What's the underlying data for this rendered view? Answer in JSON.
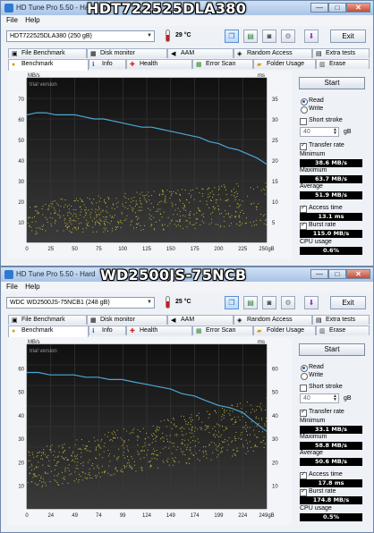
{
  "windows": [
    {
      "title": "HD Tune Pro 5.50 - Hard",
      "overlay_label": "HDT722525DLA380",
      "menu": {
        "file": "File",
        "help": "Help"
      },
      "drive_select": "HDT722525DLA380 (250 gB)",
      "temperature": "29 °C",
      "window_controls": {
        "minimize": "—",
        "maximize": "□",
        "close": "✕"
      },
      "exit_label": "Exit",
      "tabs_row1": [
        "File Benchmark",
        "Disk monitor",
        "AAM",
        "Random Access",
        "Extra tests"
      ],
      "tabs_row2": [
        "Benchmark",
        "Info",
        "Health",
        "Error Scan",
        "Folder Usage",
        "Erase"
      ],
      "side": {
        "start": "Start",
        "read": "Read",
        "write": "Write",
        "short_stroke": "Short stroke",
        "short_stroke_value": "40",
        "unit_gb": "gB",
        "transfer_rate": "Transfer rate",
        "minimum_label": "Minimum",
        "minimum": "38.6 MB/s",
        "maximum_label": "Maximum",
        "maximum": "63.7 MB/s",
        "average_label": "Average",
        "average": "51.9 MB/s",
        "access_time": "Access time",
        "access_time_value": "13.1 ms",
        "burst_rate": "Burst rate",
        "burst_rate_value": "115.0 MB/s",
        "cpu_usage": "CPU usage",
        "cpu_usage_value": "0.6%"
      },
      "chart_data": {
        "type": "line",
        "watermark": "trial version",
        "y_left_unit": "MB/s",
        "y_right_unit": "ms",
        "y_left_ticks": [
          "70",
          "60",
          "50",
          "40",
          "30",
          "20",
          "10"
        ],
        "y_right_ticks": [
          "35",
          "30",
          "25",
          "20",
          "15",
          "10",
          "5"
        ],
        "x_ticks": [
          "0",
          "25",
          "50",
          "75",
          "100",
          "125",
          "150",
          "175",
          "200",
          "225",
          "250gB"
        ],
        "ylim_left": [
          0,
          80
        ],
        "ylim_right": [
          0,
          40
        ],
        "xlim": [
          0,
          250
        ],
        "series": [
          {
            "color": "#4aa8d8",
            "x": [
              0,
              10,
              20,
              30,
              40,
              50,
              60,
              70,
              80,
              90,
              100,
              110,
              120,
              130,
              140,
              150,
              160,
              170,
              180,
              190,
              200,
              210,
              220,
              230,
              240,
              250
            ],
            "values": [
              62,
              63,
              63,
              62,
              62,
              62,
              61,
              60,
              60,
              59,
              58,
              57,
              56,
              56,
              55,
              54,
              53,
              52,
              51,
              49,
              48,
              46,
              45,
              43,
              41,
              38
            ]
          },
          {
            "color": "#d9cf3a",
            "kind": "scatter",
            "x_range": [
              0,
              250
            ],
            "values_start": [
              4,
              20
            ],
            "values_end": [
              8,
              30
            ],
            "count": 600
          }
        ]
      }
    },
    {
      "title": "HD Tune Pro 5.50 - Hard",
      "overlay_label": "WD2500JS-75NCB",
      "menu": {
        "file": "File",
        "help": "Help"
      },
      "drive_select": "WDC WD2500JS-75NCB1 (248 gB)",
      "temperature": "25 °C",
      "window_controls": {
        "minimize": "—",
        "maximize": "□",
        "close": "✕"
      },
      "exit_label": "Exit",
      "tabs_row1": [
        "File Benchmark",
        "Disk monitor",
        "AAM",
        "Random Access",
        "Extra tests"
      ],
      "tabs_row2": [
        "Benchmark",
        "Info",
        "Health",
        "Error Scan",
        "Folder Usage",
        "Erase"
      ],
      "side": {
        "start": "Start",
        "read": "Read",
        "write": "Write",
        "short_stroke": "Short stroke",
        "short_stroke_value": "40",
        "unit_gb": "gB",
        "transfer_rate": "Transfer rate",
        "minimum_label": "Minimum",
        "minimum": "33.1 MB/s",
        "maximum_label": "Maximum",
        "maximum": "58.8 MB/s",
        "average_label": "Average",
        "average": "50.6 MB/s",
        "access_time": "Access time",
        "access_time_value": "17.8 ms",
        "burst_rate": "Burst rate",
        "burst_rate_value": "174.8 MB/s",
        "cpu_usage": "CPU usage",
        "cpu_usage_value": "0.5%"
      },
      "chart_data": {
        "type": "line",
        "watermark": "trial version",
        "y_left_unit": "MB/s",
        "y_right_unit": "ms",
        "y_left_ticks": [
          "60",
          "50",
          "40",
          "30",
          "20",
          "10"
        ],
        "y_right_ticks": [
          "60",
          "50",
          "40",
          "30",
          "20",
          "10"
        ],
        "x_ticks": [
          "0",
          "24",
          "49",
          "74",
          "99",
          "124",
          "149",
          "174",
          "199",
          "224",
          "249gB"
        ],
        "ylim_left": [
          0,
          70
        ],
        "ylim_right": [
          0,
          70
        ],
        "xlim": [
          0,
          249
        ],
        "series": [
          {
            "color": "#4aa8d8",
            "x": [
              0,
              12,
              24,
              36,
              49,
              61,
              74,
              86,
              99,
              111,
              124,
              136,
              149,
              161,
              174,
              186,
              199,
              211,
              224,
              236,
              249
            ],
            "values": [
              58,
              58,
              57,
              57,
              57,
              56,
              56,
              55,
              55,
              54,
              53,
              52,
              51,
              49,
              48,
              46,
              44,
              43,
              41,
              37,
              33
            ]
          },
          {
            "color": "#d9cf3a",
            "kind": "scatter",
            "x_range": [
              0,
              249
            ],
            "values_start": [
              8,
              25
            ],
            "values_end": [
              25,
              48
            ],
            "count": 700
          }
        ]
      }
    }
  ]
}
